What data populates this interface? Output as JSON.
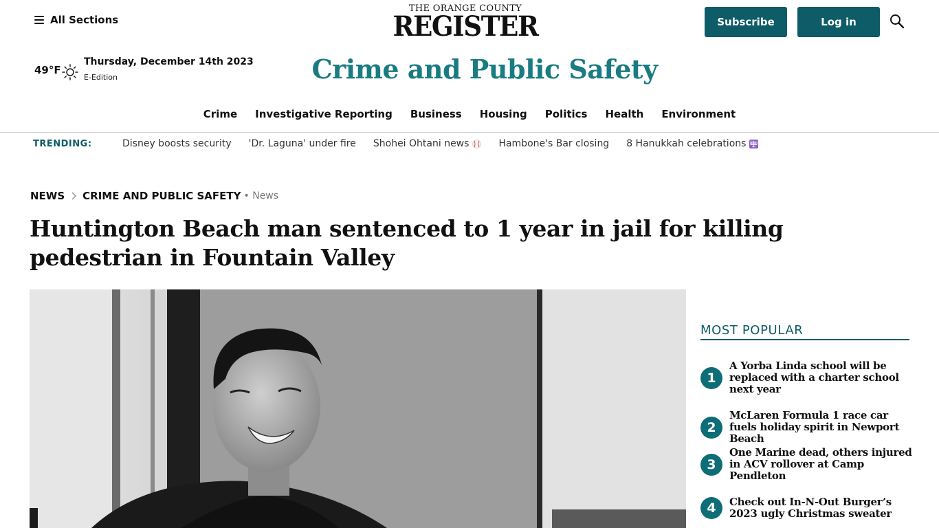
{
  "header": {
    "all_sections_label": "All Sections",
    "logo_top": "THE ORANGE COUNTY",
    "logo_main": "REGISTER",
    "subscribe_label": "Subscribe",
    "login_label": "Log in",
    "weather_temp": "49°F",
    "date": "Thursday, December 14th 2023",
    "eedition_label": "E-Edition",
    "section_title": "Crime and Public Safety",
    "brand_color": "#0e5c67",
    "title_color": "#1a7b82"
  },
  "nav": {
    "items": [
      {
        "label": "Crime"
      },
      {
        "label": "Investigative Reporting"
      },
      {
        "label": "Business"
      },
      {
        "label": "Housing"
      },
      {
        "label": "Politics"
      },
      {
        "label": "Health"
      },
      {
        "label": "Environment"
      }
    ]
  },
  "trending": {
    "label": "TRENDING:",
    "items": [
      {
        "label": "Disney boosts security",
        "icon": ""
      },
      {
        "label": "'Dr. Laguna' under fire",
        "icon": ""
      },
      {
        "label": "Shohei Ohtani news",
        "icon": "baseball-emoji"
      },
      {
        "label": "Hambone's Bar closing",
        "icon": ""
      },
      {
        "label": "8 Hanukkah celebrations",
        "icon": "menorah-emoji"
      }
    ]
  },
  "breadcrumb": {
    "items": [
      "NEWS",
      "CRIME AND PUBLIC SAFETY"
    ],
    "sub": "• News"
  },
  "article": {
    "headline": "Huntington Beach man sentenced to 1 year in jail for killing pedestrian in Fountain Valley",
    "image_alt": "Black and white photo of a smiling man in a dark shirt"
  },
  "most_popular": {
    "title": "MOST POPULAR",
    "items": [
      {
        "rank": "1",
        "title": "A Yorba Linda school will be replaced with a charter school next year"
      },
      {
        "rank": "2",
        "title": "McLaren Formula 1 race car fuels holiday spirit in Newport Beach"
      },
      {
        "rank": "3",
        "title": "One Marine dead, others injured in ACV rollover at Camp Pendleton"
      },
      {
        "rank": "4",
        "title": "Check out In-N-Out Burger’s 2023 ugly Christmas sweater"
      }
    ]
  }
}
